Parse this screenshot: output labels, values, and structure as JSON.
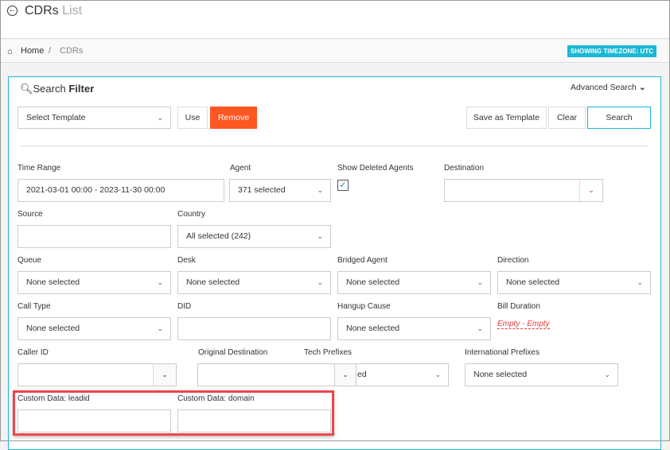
{
  "header": {
    "title": "CDRs",
    "title_suffix": "List"
  },
  "breadcrumb": {
    "home": "Home",
    "separator": "/",
    "current": "CDRs",
    "timezone_badge": "SHOWING TIMEZONE: UTC"
  },
  "filter": {
    "title_prefix": "Search",
    "title": "Filter",
    "advanced": "Advanced Search",
    "template_select": "Select Template",
    "use": "Use",
    "remove": "Remove",
    "save_template": "Save as Template",
    "clear": "Clear",
    "search": "Search"
  },
  "fields": {
    "time_range": {
      "label": "Time Range",
      "value": "2021-03-01 00:00 - 2023-11-30 00:00"
    },
    "agent": {
      "label": "Agent",
      "value": "371 selected"
    },
    "show_deleted": {
      "label": "Show Deleted Agents",
      "checked": true
    },
    "destination": {
      "label": "Destination",
      "value": ""
    },
    "source": {
      "label": "Source",
      "value": ""
    },
    "country": {
      "label": "Country",
      "value": "All selected (242)"
    },
    "queue": {
      "label": "Queue",
      "value": "None selected"
    },
    "desk": {
      "label": "Desk",
      "value": "None selected"
    },
    "bridged_agent": {
      "label": "Bridged Agent",
      "value": "None selected"
    },
    "direction": {
      "label": "Direction",
      "value": "None selected"
    },
    "call_type": {
      "label": "Call Type",
      "value": "None selected"
    },
    "did": {
      "label": "DID",
      "value": ""
    },
    "hangup_cause": {
      "label": "Hangup Cause",
      "value": "None selected"
    },
    "bill_duration": {
      "label": "Bill Duration",
      "value": "Empty - Empty"
    },
    "caller_id": {
      "label": "Caller ID",
      "value": ""
    },
    "original_destination": {
      "label": "Original Destination",
      "value": ""
    },
    "tech_prefixes": {
      "label": "Tech Prefixes",
      "value": "ed"
    },
    "international_prefixes": {
      "label": "International Prefixes",
      "value": "None selected"
    },
    "custom_leadid": {
      "label": "Custom Data: leadid",
      "value": ""
    },
    "custom_domain": {
      "label": "Custom Data: domain",
      "value": ""
    }
  },
  "colors": {
    "accent": "#1ab8d4",
    "remove": "#ff5722",
    "highlight": "#f0444b",
    "bill_duration": "#e53935"
  }
}
